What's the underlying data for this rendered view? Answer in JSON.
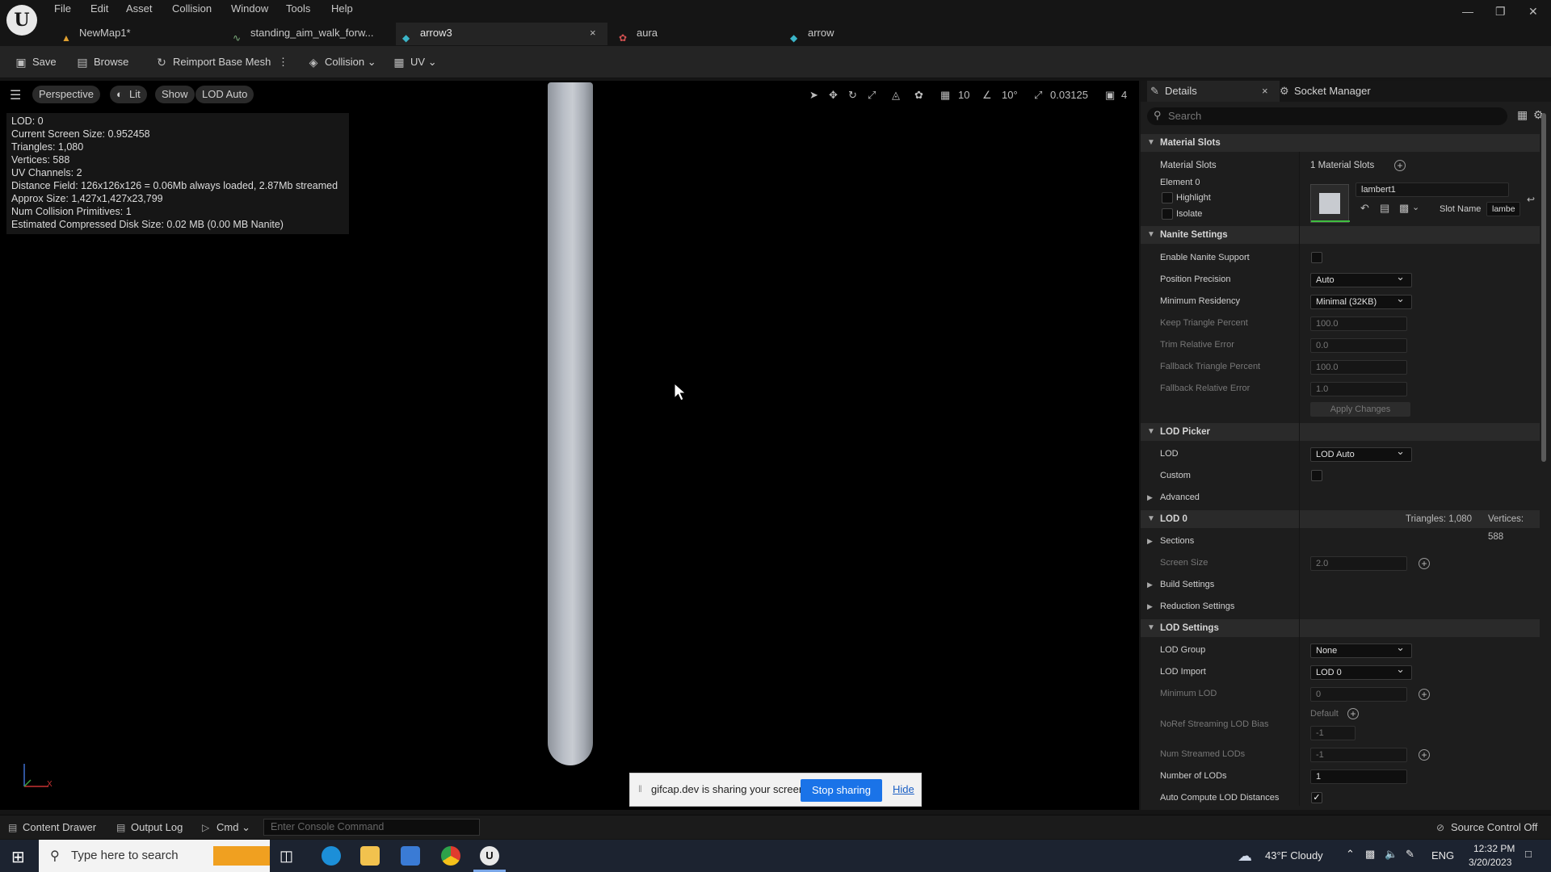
{
  "menu": [
    "File",
    "Edit",
    "Asset",
    "Collision",
    "Window",
    "Tools",
    "Help"
  ],
  "tabs": [
    "NewMap1*",
    "standing_aim_walk_forw...",
    "arrow3",
    "aura",
    "arrow"
  ],
  "toolbar": {
    "save": "Save",
    "browse": "Browse",
    "reimport": "Reimport Base Mesh",
    "collision": "Collision",
    "uv": "UV"
  },
  "viewport": {
    "perspective": "Perspective",
    "lit": "Lit",
    "show": "Show",
    "lod": "LOD Auto",
    "grid_snap": "10",
    "angle_snap": "10°",
    "scale_snap": "0.03125",
    "camera_speed": "4",
    "stats": [
      "LOD:  0",
      "Current Screen Size:  0.952458",
      "Triangles:  1,080",
      "Vertices:  588",
      "UV Channels:  2",
      "Distance Field:  126x126x126 = 0.06Mb always loaded, 2.87Mb streamed",
      "Approx Size: 1,427x1,427x23,799",
      "Num Collision Primitives:  1",
      "Estimated Compressed Disk Size: 0.02 MB (0.00 MB Nanite)"
    ],
    "axis_x": "X"
  },
  "share": {
    "text": "gifcap.dev is sharing your screen.",
    "stop": "Stop sharing",
    "hide": "Hide"
  },
  "details": {
    "tab_details": "Details",
    "tab_socket": "Socket Manager",
    "search_placeholder": "Search",
    "material_slots": {
      "header": "Material Slots",
      "label": "Material Slots",
      "value": "1 Material Slots",
      "element": "Element 0",
      "highlight": "Highlight",
      "isolate": "Isolate",
      "material_name": "lambert1",
      "slot_name_label": "Slot Name",
      "slot_name_value": "lambe"
    },
    "nanite": {
      "header": "Nanite Settings",
      "enable": "Enable Nanite Support",
      "position_precision": "Position Precision",
      "position_precision_value": "Auto",
      "min_residency": "Minimum Residency",
      "min_residency_value": "Minimal (32KB)",
      "keep_triangle": "Keep Triangle Percent",
      "keep_triangle_value": "100.0",
      "trim_error": "Trim Relative Error",
      "trim_error_value": "0.0",
      "fallback_triangle": "Fallback Triangle Percent",
      "fallback_triangle_value": "100.0",
      "fallback_error": "Fallback Relative Error",
      "fallback_error_value": "1.0",
      "apply": "Apply Changes"
    },
    "lod_picker": {
      "header": "LOD Picker",
      "lod": "LOD",
      "lod_value": "LOD Auto",
      "custom": "Custom",
      "advanced": "Advanced"
    },
    "lod0": {
      "header": "LOD 0",
      "triangles": "Triangles: 1,080",
      "vertices": "Vertices: 588",
      "sections": "Sections",
      "screen_size": "Screen Size",
      "screen_size_value": "2.0",
      "build_settings": "Build Settings",
      "reduction_settings": "Reduction Settings"
    },
    "lod_settings": {
      "header": "LOD Settings",
      "lod_group": "LOD Group",
      "lod_group_value": "None",
      "lod_import": "LOD Import",
      "lod_import_value": "LOD 0",
      "min_lod": "Minimum LOD",
      "min_lod_value": "0",
      "noref_bias": "NoRef Streaming LOD Bias",
      "noref_default": "Default",
      "noref_value": "-1",
      "num_streamed": "Num Streamed LODs",
      "num_streamed_value": "-1",
      "number_of_lods": "Number of LODs",
      "number_of_lods_value": "1",
      "auto_compute": "Auto Compute LOD Distances"
    }
  },
  "statusbar": {
    "content_drawer": "Content Drawer",
    "output_log": "Output Log",
    "cmd": "Cmd",
    "console_placeholder": "Enter Console Command",
    "source_control": "Source Control Off"
  },
  "taskbar": {
    "search_placeholder": "Type here to search",
    "weather": "43°F  Cloudy",
    "lang": "ENG",
    "time": "12:32 PM",
    "date": "3/20/2023"
  }
}
